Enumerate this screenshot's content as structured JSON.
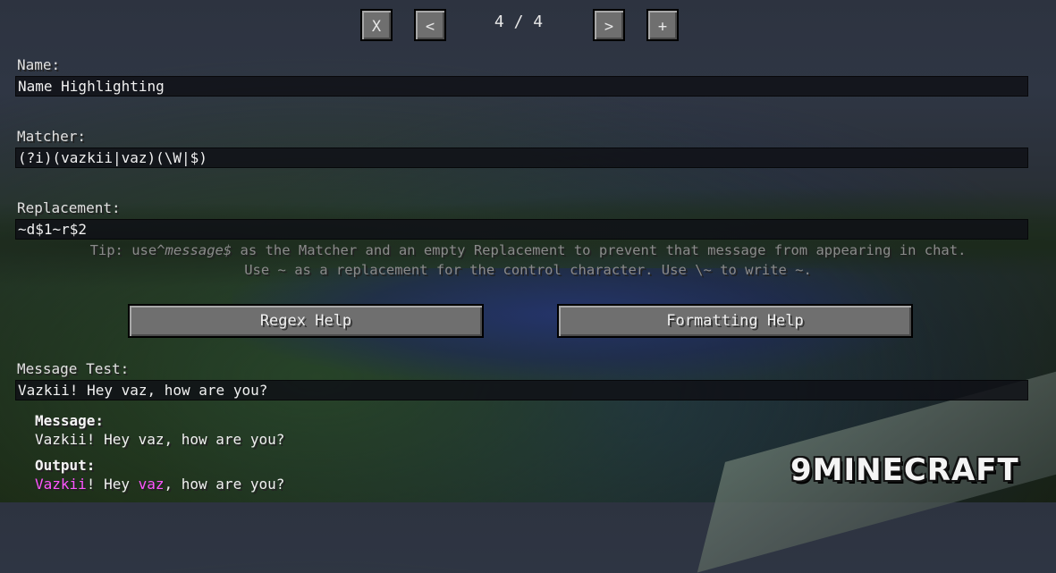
{
  "nav": {
    "close_label": "X",
    "prev_label": "<",
    "page_indicator": "4 / 4",
    "next_label": ">",
    "add_label": "+"
  },
  "name": {
    "label": "Name:",
    "value": "Name Highlighting"
  },
  "matcher": {
    "label": "Matcher:",
    "value": "(?i)(vazkii|vaz)(\\W|$)"
  },
  "replacement": {
    "label": "Replacement:",
    "value": "~d$1~r$2"
  },
  "tip": {
    "line1_pre": "Tip: use",
    "line1_em": "^message$",
    "line1_post": " as the Matcher and an empty Replacement to prevent that message from appearing in chat.",
    "line2": "Use ~ as a replacement for the control character. Use \\~ to write ~."
  },
  "buttons": {
    "regex_help": "Regex Help",
    "formatting_help": "Formatting Help"
  },
  "message_test": {
    "label": "Message Test:",
    "value": "Vazkii! Hey vaz, how are you?"
  },
  "result": {
    "message_label": "Message:",
    "message_value": "Vazkii! Hey vaz, how are you?",
    "output_label": "Output:",
    "output_segments": [
      "Vazkii",
      "! Hey ",
      "vaz",
      ", how are you?"
    ],
    "highlight_color": "#ff55ff"
  },
  "watermark": "9MINECRAFT"
}
